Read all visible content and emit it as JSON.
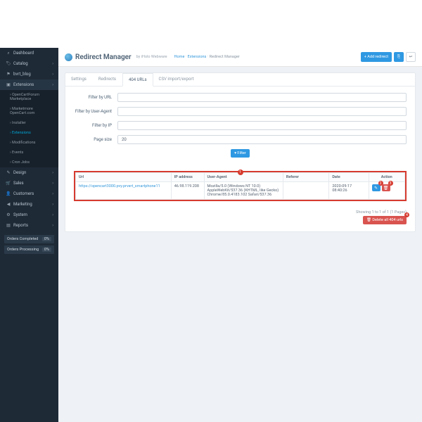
{
  "sidebar": {
    "items": [
      {
        "icon": "⌕",
        "label": "Dashboard",
        "chev": false
      },
      {
        "icon": "🏷",
        "label": "Catalog",
        "chev": true
      },
      {
        "icon": "⚑",
        "label": "bvrt_blog",
        "chev": true
      },
      {
        "icon": "▣",
        "label": "Extensions",
        "chev": true,
        "active": true,
        "sub": [
          {
            "label": "OpenCartForum Marketplace"
          },
          {
            "label": "Marketmore OpenCart.com"
          },
          {
            "label": "Installer"
          },
          {
            "label": "Extensions",
            "highlight": true
          },
          {
            "label": "Modifications"
          },
          {
            "label": "Events"
          },
          {
            "label": "Cron Jobs"
          }
        ]
      },
      {
        "icon": "✎",
        "label": "Design",
        "chev": true
      },
      {
        "icon": "🛒",
        "label": "Sales",
        "chev": true
      },
      {
        "icon": "👤",
        "label": "Customers",
        "chev": true
      },
      {
        "icon": "◀",
        "label": "Marketing",
        "chev": true
      },
      {
        "icon": "⚙",
        "label": "System",
        "chev": true
      },
      {
        "icon": "▤",
        "label": "Reports",
        "chev": true
      }
    ],
    "stats": [
      {
        "label": "Orders Completed",
        "value": "0%"
      },
      {
        "label": "Orders Processing",
        "value": "0%"
      }
    ]
  },
  "header": {
    "title": "Redirect Manager",
    "subtitle": "by iHolo Webware",
    "crumbs": {
      "home": "Home",
      "sep": "›",
      "ext": "Extensions",
      "current": "Redirect Manager"
    },
    "add_btn": "+ Add redirect",
    "copy_icon": "⎘",
    "back_icon": "↩"
  },
  "tabs": [
    "Settings",
    "Redirects",
    "404 URLs",
    "CSV import/export"
  ],
  "active_tab": 2,
  "filters": {
    "url_label": "Filter by URL",
    "ua_label": "Filter by User-Agent",
    "ip_label": "Filter by IP",
    "size_label": "Page size",
    "size_value": "20",
    "filter_btn": "▾ Filter"
  },
  "table": {
    "headers": [
      "Url",
      "IP address",
      "User-Agent",
      "Referer",
      "Date",
      "Action"
    ],
    "rows": [
      {
        "url": "https://opencart3000.pvy.prvert_smartphone11",
        "ip": "46.98.119.208",
        "ua": "Mozilla/5.0 (Windows NT 10.0) AppleWebKit/537.36 (KHTML, like Gecko) Chrome/85.0.4183.102 Safari/537.36",
        "referer": "",
        "date": "2020-09-17 08:40:26"
      }
    ],
    "markers": {
      "top": "1",
      "edit": "2",
      "delete": "3",
      "delall": "4"
    }
  },
  "footer": {
    "showing": "Showing 1 to 1 of 1 (1 Pages)",
    "delete_all": "🗑 Delete all 404 urls"
  }
}
